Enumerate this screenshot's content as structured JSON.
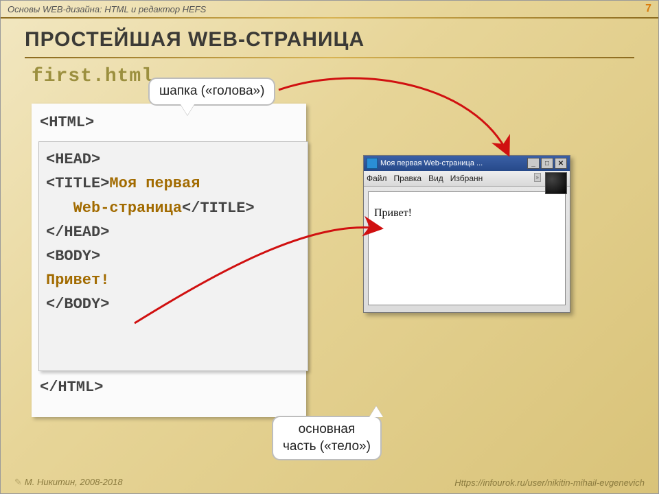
{
  "header": {
    "context": "Основы WEB-дизайна: HTML и редактор HEFS",
    "page_number": "7"
  },
  "title": "Простейшая Web-страница",
  "filename": "first.html",
  "code": {
    "l1": "<HTML>",
    "l2": "<HEAD>",
    "l3a": "<TITLE>",
    "l3b": "Моя первая",
    "l4a": "Web-страница",
    "l4b": "</TITLE>",
    "l5": "</HEAD>",
    "l6": "<BODY>",
    "l7": "Привет!",
    "l8": "</BODY>",
    "l9": "</HTML>"
  },
  "callouts": {
    "head": "шапка («голова»)",
    "body_line1": "основная",
    "body_line2": "часть («тело»)"
  },
  "browser": {
    "title": "Моя первая Web-страница ...",
    "menu": [
      "Файл",
      "Правка",
      "Вид",
      "Избранн"
    ],
    "win_min": "_",
    "win_max": "□",
    "win_close": "✕",
    "content": "Привет!"
  },
  "footer": {
    "author": "М. Никитин, 2008-2018",
    "url": "Https://infourok.ru/user/nikitin-mihail-evgenevich"
  }
}
